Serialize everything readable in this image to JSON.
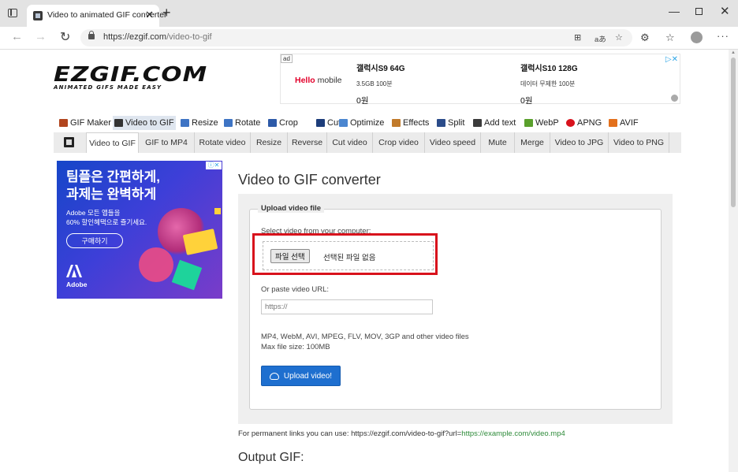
{
  "browser": {
    "tab_title": "Video to animated GIF converter",
    "url_domain": "https://ezgif.com",
    "url_path": "/video-to-gif"
  },
  "logo": {
    "main": "EZGIF.COM",
    "tagline": "ANIMATED GIFS MADE EASY"
  },
  "top_ad": {
    "badge": "ad",
    "brand": "Hello",
    "brand_suffix": "mobile",
    "offers": [
      {
        "title": "갤럭시S9 64G",
        "spec": "3.5GB 100분",
        "price": "0원"
      },
      {
        "title": "갤럭시S10 128G",
        "spec": "데이터 무제한 100분",
        "price": "0원"
      }
    ]
  },
  "main_nav": [
    {
      "label": "GIF Maker",
      "icon": "gif-maker-icon",
      "color": "#b1451e"
    },
    {
      "label": "Video to GIF",
      "icon": "video-to-gif-icon",
      "color": "#333333",
      "active": true
    },
    {
      "label": "Resize",
      "icon": "resize-icon",
      "color": "#3e74c4"
    },
    {
      "label": "Rotate",
      "icon": "rotate-icon",
      "color": "#3e74c4"
    },
    {
      "label": "Crop",
      "icon": "crop-icon",
      "color": "#2d5aa8"
    },
    {
      "label": "Cut",
      "icon": "cut-icon",
      "color": "#1d3d7a"
    },
    {
      "label": "Optimize",
      "icon": "optimize-icon",
      "color": "#4b86d0"
    },
    {
      "label": "Effects",
      "icon": "effects-icon",
      "color": "#c17a2a"
    },
    {
      "label": "Split",
      "icon": "split-icon",
      "color": "#2b4c8a"
    },
    {
      "label": "Add text",
      "icon": "add-text-icon",
      "color": "#3b3b3b"
    },
    {
      "label": "WebP",
      "icon": "webp-icon",
      "color": "#5aa02c"
    },
    {
      "label": "APNG",
      "icon": "apng-icon",
      "color": "#d8121c"
    },
    {
      "label": "AVIF",
      "icon": "avif-icon",
      "color": "#e3701c"
    }
  ],
  "sub_nav": [
    "Video to GIF",
    "GIF to MP4",
    "Rotate video",
    "Resize",
    "Reverse",
    "Cut video",
    "Crop video",
    "Video speed",
    "Mute",
    "Merge",
    "Video to JPG",
    "Video to PNG"
  ],
  "side_ad": {
    "headline_1": "팀플은 간편하게,",
    "headline_2": "과제는 완벽하게",
    "body_1": "Adobe 모든 앱들을",
    "body_2": "60% 할인혜택으로 즐기세요.",
    "button": "구매하기",
    "brand": "Adobe"
  },
  "main": {
    "title": "Video to GIF converter",
    "legend": "Upload video file",
    "select_label": "Select video from your computer:",
    "file_button": "파일 선택",
    "file_status": "선택된 파일 없음",
    "url_label": "Or paste video URL:",
    "url_placeholder": "https://",
    "info_line_1": "MP4, WebM, AVI, MPEG, FLV, MOV, 3GP and other video files",
    "info_line_2": "Max file size: 100MB",
    "upload_button": "Upload video!",
    "perma_prefix": "For permanent links you can use: https://ezgif.com/video-to-gif?url=",
    "perma_example": "https://example.com/video.mp4",
    "output_title": "Output GIF:"
  },
  "colors": {
    "accent_blue": "#1e6fcf",
    "highlight_red": "#d8121c"
  }
}
